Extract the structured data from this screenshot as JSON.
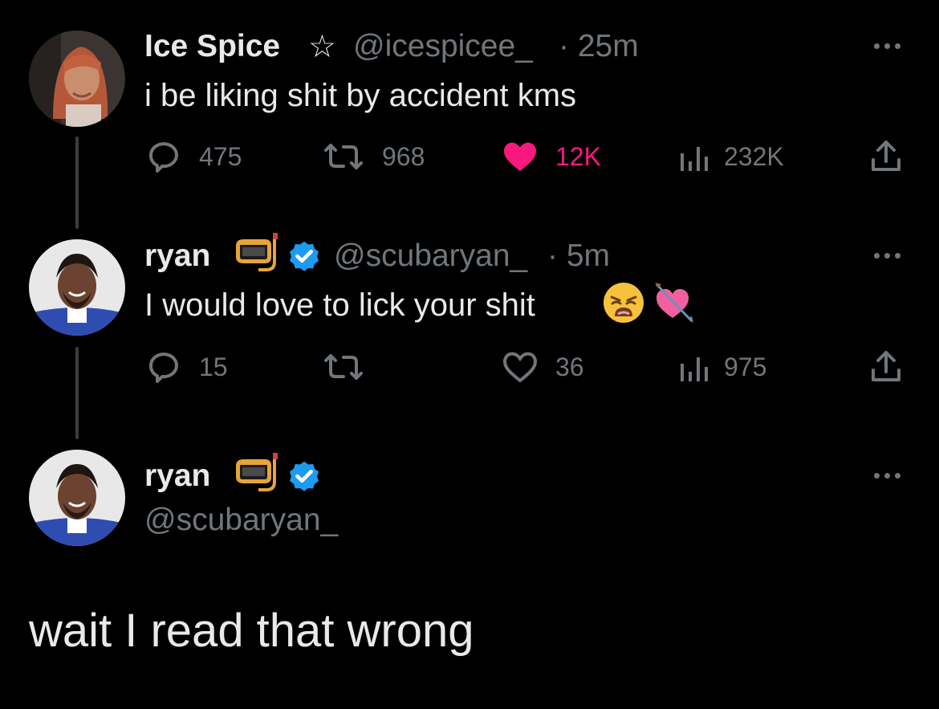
{
  "tweets": [
    {
      "name": "Ice Spice",
      "name_suffix": "☆",
      "handle": "@icespicee_",
      "time": "· 25m",
      "text": "i be liking shit by accident kms",
      "replies": "475",
      "retweets": "968",
      "likes": "12K",
      "views": "232K",
      "liked": true
    },
    {
      "name": "ryan",
      "handle": "@scubaryan_",
      "time": "· 5m",
      "text": "I would love to lick your shit",
      "emoji": [
        "weary-face",
        "heart-with-arrow"
      ],
      "replies": "15",
      "retweets": "",
      "likes": "36",
      "views": "975",
      "liked": false
    }
  ],
  "focused_tweet": {
    "name": "ryan",
    "handle": "@scubaryan_",
    "text": "wait I read that wrong"
  },
  "colors": {
    "background": "#000000",
    "text": "#e7e9ea",
    "muted": "#71767b",
    "like_pink": "#f91880",
    "verified_blue": "#1d9bf0"
  }
}
